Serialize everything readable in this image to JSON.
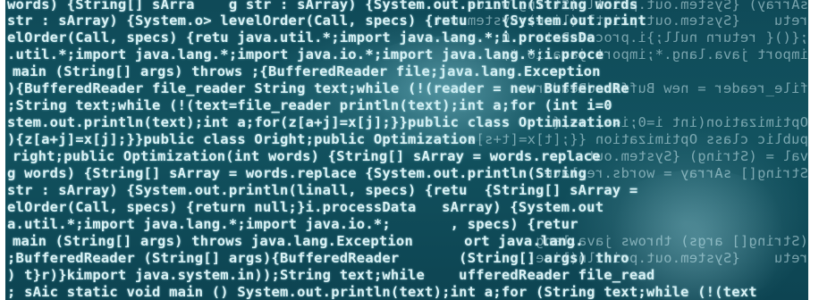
{
  "rows": [
    "words) {String[] sArra    g str : sArray) {System.out.println(String words",
    "str : sArray) {System.o> levelOrder(Call, specs) {retu    {System.out.print",
    "elOrder(Call, specs) {retu java.util.*;import java.lang.*;i.processDa",
    ".util.*;import java.lang.*;import java.io.*;import java.lang.*;i.proce",
    "main (String[] args) throws ;{BufferedReader file;java.lang.Exception",
    "){BufferedReader file_reader String text;while (!(reader = new BufferedRe",
    ";String text;while (!(text=file_reader println(text);int a;for (int i=0",
    "stem.out.println(text);int a;for(z[a+j]=x[j];}}public class Optimization",
    "){z[a+j]=x[j];}}public class Oright;public Optimization",
    "right;public Optimization(int words) {String[] sArray = words.replace",
    "g words) {String[] sArray = words.replace {System.out.println(String",
    "str : sArray) {System.out.println(linall, specs) {retu  {String[] sArray =",
    "elOrder(Call, specs) {return null;}i.processData   sArray) {System.out",
    "a.util.*;import java.lang.*;import java.io.*;       , specs) {retur",
    "main (String[] args) throws java.lang.Exception      ort java.lang.",
    ";BufferedReader (String[] args){BufferedReader       (String[] args) thro",
    ") t}r)}kimport java.system.in));String text;while    ufferedReader file_read",
    "; sAic static void main () System.out.println(text);int a;for (String text;while (!(text"
  ],
  "mirrored_rows": [
    "sArray) {System.out.println(String words",
    "retu    {System.out.println(line);System.out.",
    ";{(){ return null;}i.processData   O",
    "import java.lang.*;import java.io.*;",
    "file_reader = new BufferedReader",
    "Optimization(int i=0;i<a;i++){",
    "public class Optimization {{;[t]x=[t+s]z",
    "val = (String) {System.out",
    "String[] sArray = words.replace",
    "(String[] args) throws java.lang",
    "retu    {System.out.println(line)"
  ]
}
